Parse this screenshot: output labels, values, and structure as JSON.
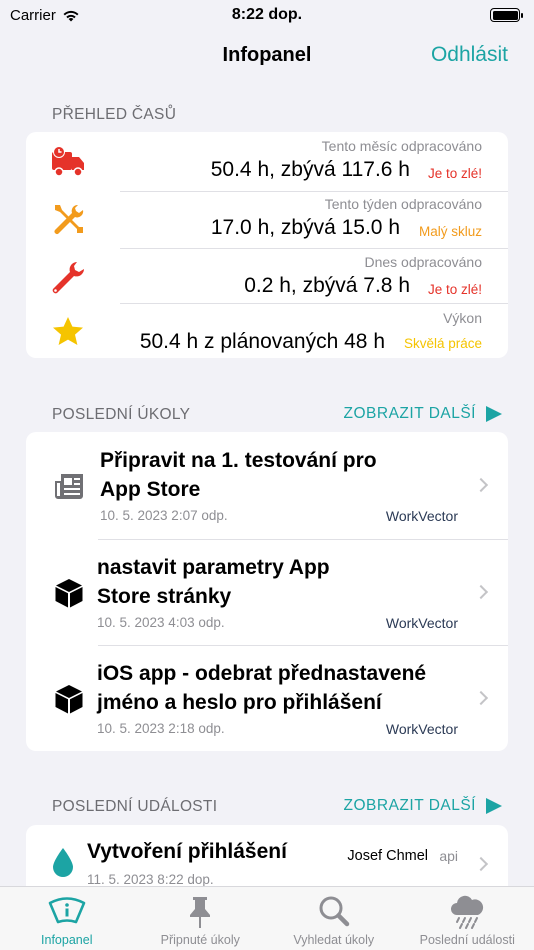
{
  "status_bar": {
    "carrier": "Carrier",
    "time": "8:22 dop."
  },
  "nav": {
    "title": "Infopanel",
    "action": "Odhlásit"
  },
  "overview": {
    "header": "PŘEHLED ČASŮ",
    "rows": [
      {
        "icon": "truck-icon",
        "caption": "Tento měsíc odpracováno",
        "value": "50.4 h, zbývá 117.6 h",
        "status": "Je to zlé!",
        "status_color": "#e5332a"
      },
      {
        "icon": "tools-icon",
        "caption": "Tento týden odpracováno",
        "value": "17.0 h, zbývá 15.0 h",
        "status": "Malý skluz",
        "status_color": "#f29b1d"
      },
      {
        "icon": "wrench-icon",
        "caption": "Dnes odpracováno",
        "value": "0.2 h, zbývá 7.8 h",
        "status": "Je to zlé!",
        "status_color": "#e5332a"
      },
      {
        "icon": "star-icon",
        "caption": "Výkon",
        "value": "50.4 h z plánovaných 48 h",
        "status": "Skvělá práce",
        "status_color": "#f5c400"
      }
    ]
  },
  "tasks": {
    "header": "POSLEDNÍ ÚKOLY",
    "more": "ZOBRAZIT DALŠÍ",
    "items": [
      {
        "icon": "newspaper-icon",
        "title1": "Připravit na 1. testování pro",
        "title2": "App Store",
        "date": "10. 5. 2023 2:07 odp.",
        "project": "WorkVector"
      },
      {
        "icon": "cube-icon",
        "title1": "nastavit parametry App",
        "title2": "Store stránky",
        "date": "10. 5. 2023 4:03 odp.",
        "project": "WorkVector"
      },
      {
        "icon": "cube-icon",
        "title1": "iOS app - odebrat přednastavené",
        "title2": "jméno a heslo pro přihlášení",
        "date": "10. 5. 2023 2:18 odp.",
        "project": "WorkVector"
      }
    ]
  },
  "events": {
    "header": "POSLEDNÍ UDÁLOSTI",
    "more": "ZOBRAZIT DALŠÍ",
    "items": [
      {
        "icon": "drop-icon",
        "title": "Vytvoření přihlášení",
        "user": "Josef Chmel",
        "source": "api",
        "date": "11. 5. 2023 8:22 dop."
      }
    ]
  },
  "tabbar": {
    "active": "Infopanel",
    "tabs": [
      {
        "label": "Infopanel",
        "icon": "dashboard-icon"
      },
      {
        "label": "Připnuté úkoly",
        "icon": "pin-icon"
      },
      {
        "label": "Vyhledat úkoly",
        "icon": "search-icon"
      },
      {
        "label": "Poslední události",
        "icon": "cloud-rain-icon"
      }
    ]
  },
  "colors": {
    "accent": "#1ca4a4",
    "bad": "#e5332a",
    "warn": "#f29b1d",
    "good": "#f5c400"
  }
}
